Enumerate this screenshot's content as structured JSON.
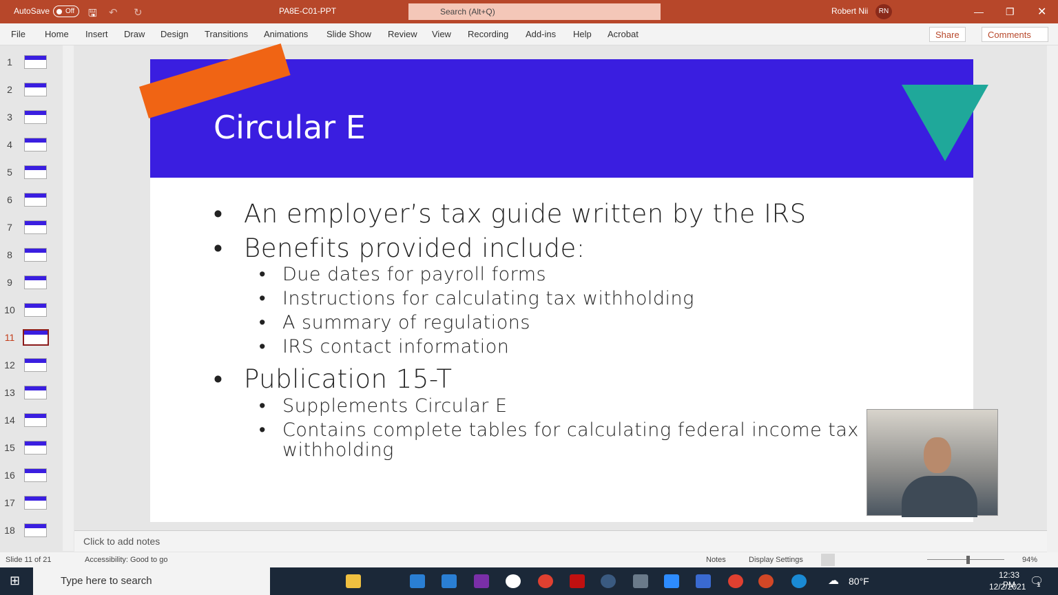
{
  "titlebar": {
    "autosave": "AutoSave",
    "autosave_state": "Off",
    "filename": "PA8E-C01-PPT",
    "search_placeholder": "Search (Alt+Q)",
    "user": "Robert Nii",
    "initials": "RN",
    "accent": "#b7472a"
  },
  "ribbon": {
    "tabs": [
      "File",
      "Home",
      "Insert",
      "Draw",
      "Design",
      "Transitions",
      "Animations",
      "Slide Show",
      "Review",
      "View",
      "Recording",
      "Add-ins",
      "Help",
      "Acrobat"
    ],
    "share": "Share",
    "comments": "Comments"
  },
  "thumbnails": [
    "1",
    "2",
    "3",
    "4",
    "5",
    "6",
    "7",
    "8",
    "9",
    "10",
    "11",
    "12",
    "13",
    "14",
    "15",
    "16",
    "17",
    "18"
  ],
  "active_slide": "11",
  "slide": {
    "title": "Circular E",
    "bullets": [
      {
        "level": 1,
        "text": "An employer’s tax guide written by the IRS"
      },
      {
        "level": 1,
        "text": "Benefits provided include:"
      },
      {
        "level": 2,
        "text": "Due dates for payroll forms"
      },
      {
        "level": 2,
        "text": "Instructions for calculating tax withholding"
      },
      {
        "level": 2,
        "text": "A summary of regulations"
      },
      {
        "level": 2,
        "text": "IRS contact information"
      },
      {
        "level": 1,
        "text": "Publication 15-T"
      },
      {
        "level": 2,
        "text": "Supplements Circular E"
      },
      {
        "level": 2,
        "text": "Contains complete tables for calculating federal income tax withholding"
      }
    ],
    "band_color": "#3a1ee0"
  },
  "notes_placeholder": "Click to add notes",
  "status": {
    "slide": "Slide 11 of 21",
    "accessibility": "Accessibility: Good to go",
    "notes": "Notes",
    "display": "Display Settings",
    "zoom": "94%"
  },
  "taskbar": {
    "search": "Type here to search",
    "weather": "80°F",
    "time": "12:33 PM",
    "date": "12/2/2021",
    "notifications": "1"
  }
}
